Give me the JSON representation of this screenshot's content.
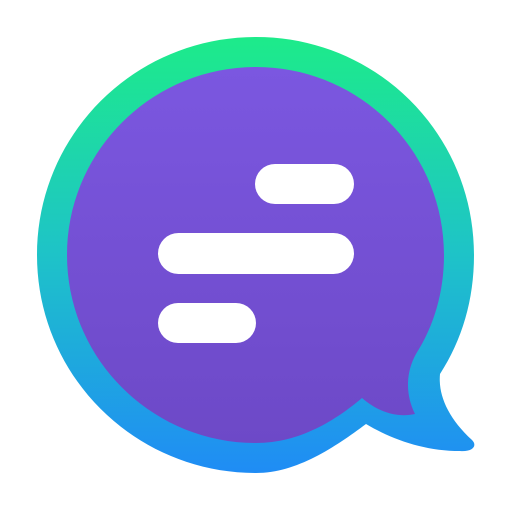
{
  "icon": {
    "name": "chat-bubble-app-icon",
    "colors": {
      "ring_top": "#1DEB8A",
      "ring_mid": "#1EC3C8",
      "ring_bottom": "#1F8CF5",
      "fill_top": "#7B57E0",
      "fill_bottom": "#6D49C7",
      "bars": "#FFFFFF",
      "background": "#FFFFFF"
    }
  }
}
